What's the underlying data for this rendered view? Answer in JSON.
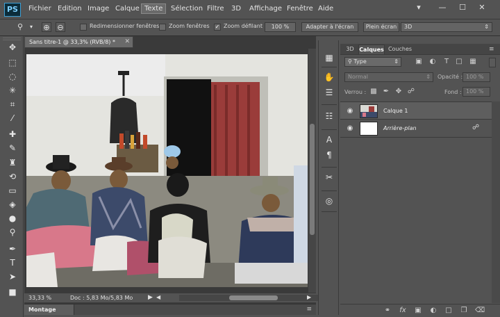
{
  "app": {
    "logo": "PS"
  },
  "menu": {
    "items": [
      "Fichier",
      "Edition",
      "Image",
      "Calque",
      "Texte",
      "Sélection",
      "Filtre",
      "3D",
      "Affichage",
      "Fenêtre",
      "Aide"
    ],
    "active_index": 4,
    "window_controls": [
      "▾",
      "—",
      "☐",
      "✕"
    ]
  },
  "options": {
    "tool_icon": "zoom-icon",
    "zoom_in_icon": "zoom-in-icon",
    "zoom_out_icon": "zoom-out-icon",
    "resize_windows": {
      "label": "Redimensionner fenêtres",
      "checked": false
    },
    "zoom_all_windows": {
      "label": "Zoom fenêtres",
      "checked": false
    },
    "scrubby_zoom": {
      "label": "Zoom défilant",
      "checked": true
    },
    "percent_button": "100 %",
    "fit_screen_button": "Adapter à l'écran",
    "fill_screen_button": "Plein écran",
    "workspace_select": "3D"
  },
  "toolbar": {
    "tools": [
      {
        "name": "move-tool-icon",
        "glyph": "✥"
      },
      {
        "name": "marquee-tool-icon",
        "glyph": "⬚"
      },
      {
        "name": "lasso-tool-icon",
        "glyph": "◌"
      },
      {
        "name": "magic-wand-tool-icon",
        "glyph": "✳"
      },
      {
        "name": "crop-tool-icon",
        "glyph": "⌗"
      },
      {
        "name": "eyedropper-tool-icon",
        "glyph": "⁄"
      },
      {
        "name": "healing-brush-tool-icon",
        "glyph": "✚"
      },
      {
        "name": "brush-tool-icon",
        "glyph": "✎"
      },
      {
        "name": "clone-stamp-tool-icon",
        "glyph": "♜"
      },
      {
        "name": "history-brush-tool-icon",
        "glyph": "⟲"
      },
      {
        "name": "eraser-tool-icon",
        "glyph": "▭"
      },
      {
        "name": "paint-bucket-tool-icon",
        "glyph": "◈"
      },
      {
        "name": "blur-tool-icon",
        "glyph": "●"
      },
      {
        "name": "dodge-tool-icon",
        "glyph": "⚲"
      },
      {
        "name": "pen-tool-icon",
        "glyph": "✒"
      },
      {
        "name": "type-tool-icon",
        "glyph": "T"
      },
      {
        "name": "path-selection-tool-icon",
        "glyph": "➤"
      },
      {
        "name": "shape-tool-icon",
        "glyph": "■"
      }
    ]
  },
  "document": {
    "tab_title": "Sans titre-1 @ 33,3% (RVB/8) *",
    "tab_close": "✕",
    "zoom_level": "33,33 %",
    "doc_info": "Doc : 5,83 Mo/5,83 Mo"
  },
  "montage": {
    "label": "Montage"
  },
  "mid_panel": {
    "icons": [
      {
        "name": "history-panel-icon",
        "glyph": "▦"
      },
      {
        "name": "brush-preset-panel-icon",
        "glyph": "✋"
      },
      {
        "name": "adjustments-panel-icon",
        "glyph": "☰"
      },
      {
        "name": "properties-panel-icon",
        "glyph": "☷"
      },
      {
        "name": "character-panel-icon",
        "glyph": "A"
      },
      {
        "name": "paragraph-panel-icon",
        "glyph": "¶"
      },
      {
        "name": "tools-presets-panel-icon",
        "glyph": "✂"
      },
      {
        "name": "3d-panel-icon",
        "glyph": "◎"
      }
    ]
  },
  "layers_panel": {
    "tabs": [
      "3D",
      "Calques",
      "Couches"
    ],
    "active_tab": 1,
    "filter_select": "Type",
    "filter_icon": "search-icon",
    "blend_mode": "Normal",
    "opacity_label": "Opacité :",
    "opacity_value": "100 %",
    "lock_label": "Verrou :",
    "fill_label": "Fond :",
    "fill_value": "100 %",
    "layers": [
      {
        "name": "Calque 1",
        "visible": true,
        "has_image": true,
        "locked": false
      },
      {
        "name": "Arrière-plan",
        "visible": true,
        "has_image": false,
        "locked": true
      }
    ],
    "footer_icons": [
      "link-icon",
      "fx-icon",
      "mask-icon",
      "adjustment-layer-icon",
      "group-icon",
      "new-layer-icon",
      "trash-icon"
    ]
  }
}
